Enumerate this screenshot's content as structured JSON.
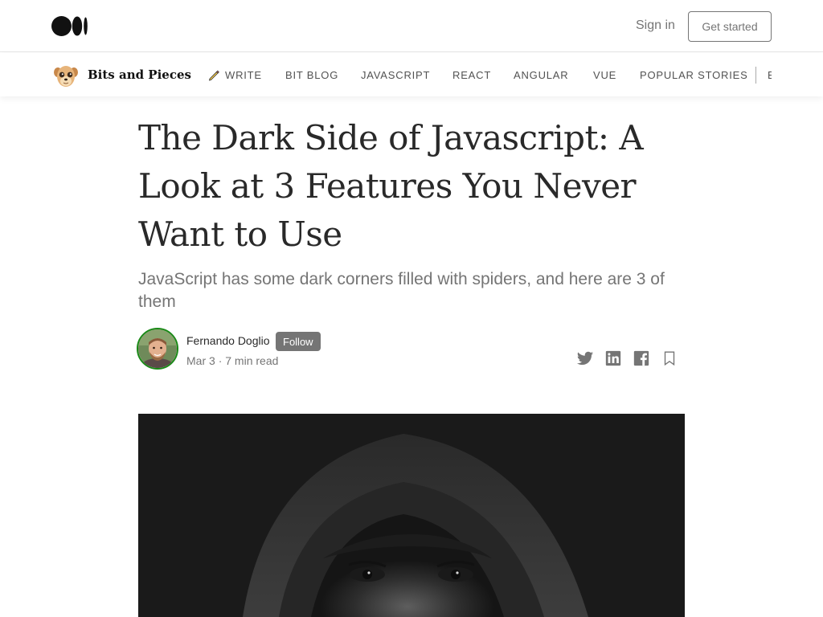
{
  "topbar": {
    "logo_icon": "medium-logo-icon",
    "signin_label": "Sign in",
    "get_started_label": "Get started"
  },
  "publication": {
    "logo_icon": "meerkat-logo-icon",
    "name": "Bits and Pieces",
    "nav": [
      {
        "label": "WRITE",
        "icon": "pencil-icon"
      },
      {
        "label": "BIT BLOG"
      },
      {
        "label": "JAVASCRIPT"
      },
      {
        "label": "REACT"
      },
      {
        "label": "ANGULAR"
      },
      {
        "label": "VUE"
      },
      {
        "label": "POPULAR STORIES"
      },
      {
        "label": "E"
      }
    ]
  },
  "article": {
    "title": "The Dark Side of Javascript: A Look at 3 Features You Never Want to Use",
    "subtitle": "JavaScript has some dark corners filled with spiders, and here are 3 of them",
    "author": {
      "name": "Fernando Doglio",
      "follow_label": "Follow",
      "date": "Mar 3",
      "separator": "·",
      "read_time": "7 min read"
    },
    "share_icons": [
      "twitter-icon",
      "linkedin-icon",
      "facebook-icon",
      "bookmark-icon"
    ],
    "hero_image": "hooded-figure-dark-photo"
  },
  "colors": {
    "text": "#292929",
    "muted": "#757575",
    "follow_bg": "#757575",
    "avatar_ring": "#1a8917"
  }
}
